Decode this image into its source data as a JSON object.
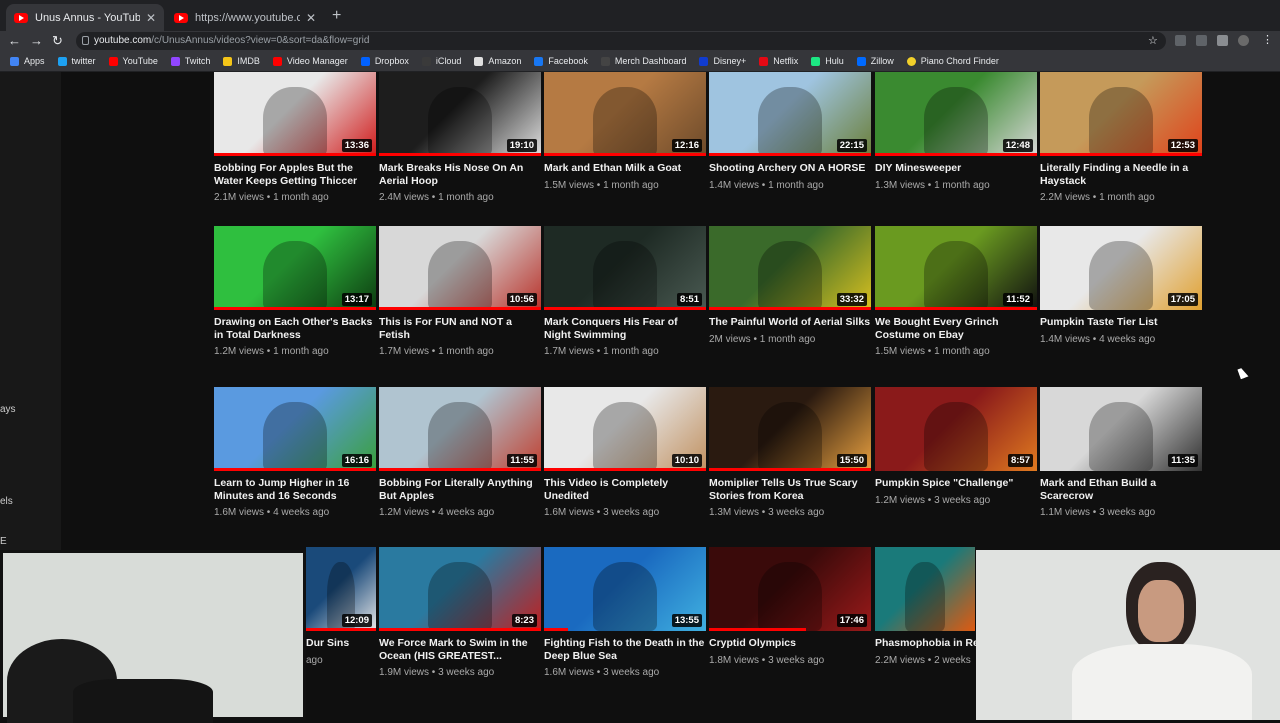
{
  "browser": {
    "tabs": [
      {
        "title": "Unus Annus - YouTube",
        "active": true
      },
      {
        "title": "https://www.youtube.com/live",
        "active": false
      }
    ],
    "url_host": "youtube.com",
    "url_path": "/c/UnusAnnus/videos?view=0&sort=da&flow=grid",
    "bookmarks": [
      "Apps",
      "twitter",
      "YouTube",
      "Twitch",
      "IMDB",
      "Video Manager",
      "Dropbox",
      "iCloud",
      "Amazon",
      "Facebook",
      "Merch Dashboard",
      "Disney+",
      "Netflix",
      "Hulu",
      "Zillow",
      "Piano Chord Finder"
    ]
  },
  "sidebar_fragments": [
    "ays",
    "els",
    "E"
  ],
  "videos": [
    {
      "title": "Bobbing For Apples But the Water Keeps Getting Thiccer",
      "duration": "13:36",
      "views": "2.1M views",
      "age": "1 month ago",
      "progress": 1.0,
      "colors": [
        "#e8e8e8",
        "#d01a1a"
      ]
    },
    {
      "title": "Mark Breaks His Nose On An Aerial Hoop",
      "duration": "19:10",
      "views": "2.4M views",
      "age": "1 month ago",
      "progress": 1.0,
      "colors": [
        "#1d1d1d",
        "#e0e0e0"
      ]
    },
    {
      "title": "Mark and Ethan Milk a Goat",
      "duration": "12:16",
      "views": "1.5M views",
      "age": "1 month ago",
      "progress": 1.0,
      "colors": [
        "#b57a43",
        "#6d4a2a"
      ]
    },
    {
      "title": "Shooting Archery ON A HORSE",
      "duration": "22:15",
      "views": "1.4M views",
      "age": "1 month ago",
      "progress": 1.0,
      "colors": [
        "#9fc4e0",
        "#6b7f3a"
      ]
    },
    {
      "title": "DIY Minesweeper",
      "duration": "12:48",
      "views": "1.3M views",
      "age": "1 month ago",
      "progress": 1.0,
      "colors": [
        "#3a8a30",
        "#d8d8d8"
      ]
    },
    {
      "title": "Literally Finding a Needle in a Haystack",
      "duration": "12:53",
      "views": "2.2M views",
      "age": "1 month ago",
      "progress": 1.0,
      "colors": [
        "#c59a5a",
        "#e0421a"
      ]
    },
    {
      "title": "Drawing on Each Other's Backs in Total Darkness",
      "duration": "13:17",
      "views": "1.2M views",
      "age": "1 month ago",
      "progress": 1.0,
      "colors": [
        "#2fbf3f",
        "#0d3a10"
      ]
    },
    {
      "title": "This is For FUN and NOT a Fetish",
      "duration": "10:56",
      "views": "1.7M views",
      "age": "1 month ago",
      "progress": 1.0,
      "colors": [
        "#d8d8d8",
        "#b8322a"
      ]
    },
    {
      "title": "Mark Conquers His Fear of Night Swimming",
      "duration": "8:51",
      "views": "1.7M views",
      "age": "1 month ago",
      "progress": 1.0,
      "colors": [
        "#1e2a24",
        "#4a5a52"
      ]
    },
    {
      "title": "The Painful World of Aerial Silks",
      "duration": "33:32",
      "views": "2M views",
      "age": "1 month ago",
      "progress": 1.0,
      "colors": [
        "#3a6a2a",
        "#d8c020"
      ]
    },
    {
      "title": "We Bought Every Grinch Costume on Ebay",
      "duration": "11:52",
      "views": "1.5M views",
      "age": "1 month ago",
      "progress": 1.0,
      "colors": [
        "#6a9a20",
        "#101010"
      ]
    },
    {
      "title": "Pumpkin Taste Tier List",
      "duration": "17:05",
      "views": "1.4M views",
      "age": "4 weeks ago",
      "progress": 0,
      "colors": [
        "#e8e8e8",
        "#e0a030"
      ]
    },
    {
      "title": "Learn to Jump Higher in 16 Minutes and 16 Seconds",
      "duration": "16:16",
      "views": "1.6M views",
      "age": "4 weeks ago",
      "progress": 1.0,
      "colors": [
        "#5a9ae0",
        "#3aa03a"
      ]
    },
    {
      "title": "Bobbing For Literally Anything But Apples",
      "duration": "11:55",
      "views": "1.2M views",
      "age": "4 weeks ago",
      "progress": 1.0,
      "colors": [
        "#b0c4d0",
        "#c04030"
      ]
    },
    {
      "title": "This Video is Completely Unedited",
      "duration": "10:10",
      "views": "1.6M views",
      "age": "3 weeks ago",
      "progress": 1.0,
      "colors": [
        "#e8e8e8",
        "#c09060"
      ]
    },
    {
      "title": "Momiplier Tells Us True Scary Stories from Korea",
      "duration": "15:50",
      "views": "1.3M views",
      "age": "3 weeks ago",
      "progress": 1.0,
      "colors": [
        "#2a1a10",
        "#e8a040"
      ]
    },
    {
      "title": "Pumpkin Spice \"Challenge\"",
      "duration": "8:57",
      "views": "1.2M views",
      "age": "3 weeks ago",
      "progress": 0,
      "colors": [
        "#8a1a1a",
        "#e07a20"
      ]
    },
    {
      "title": "Mark and Ethan Build a Scarecrow",
      "duration": "11:35",
      "views": "1.1M views",
      "age": "3 weeks ago",
      "progress": 0,
      "colors": [
        "#d8d8d8",
        "#303030"
      ]
    },
    {
      "title": "Dur Sins",
      "duration": "12:09",
      "views": "",
      "age": "ago",
      "progress": 1.0,
      "colors": [
        "#1a4a7a",
        "#e8e8e8"
      ]
    },
    {
      "title": "We Force Mark to Swim in the Ocean (HIS GREATEST...",
      "duration": "8:23",
      "views": "1.9M views",
      "age": "3 weeks ago",
      "progress": 1.0,
      "colors": [
        "#2a7aa0",
        "#c02020"
      ]
    },
    {
      "title": "Fighting Fish to the Death in the Deep Blue Sea",
      "duration": "13:55",
      "views": "1.6M views",
      "age": "3 weeks ago",
      "progress": 0.15,
      "colors": [
        "#1a6ac0",
        "#40b0e0"
      ]
    },
    {
      "title": "Cryptid Olympics",
      "duration": "17:46",
      "views": "1.8M views",
      "age": "3 weeks ago",
      "progress": 0.6,
      "colors": [
        "#3a0a0a",
        "#9a1a1a"
      ]
    },
    {
      "title": "Phasmophobia in Re",
      "duration": "",
      "views": "2.2M views",
      "age": "2 weeks",
      "progress": 0,
      "colors": [
        "#1a7a7a",
        "#e05a10"
      ]
    }
  ],
  "overlays": {
    "cam_left": {
      "colors": [
        "#d8dcd8",
        "#1a1a1a"
      ]
    },
    "cam_right": {
      "colors": [
        "#e0e2e0",
        "#f0f0f0"
      ]
    }
  }
}
